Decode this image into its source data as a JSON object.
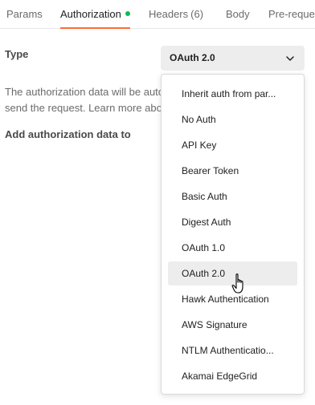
{
  "tabs": [
    {
      "label": "Params",
      "active": false
    },
    {
      "label": "Authorization",
      "active": true,
      "status_dot": true
    },
    {
      "label": "Headers",
      "count": "(6)",
      "active": false
    },
    {
      "label": "Body",
      "active": false
    },
    {
      "label": "Pre-reque",
      "active": false
    }
  ],
  "auth": {
    "type_label": "Type",
    "description_line1": "The authorization data will be auto",
    "description_line2": "send the request. Learn more abou",
    "add_to_label": "Add authorization data to"
  },
  "select": {
    "value": "OAuth 2.0"
  },
  "menu": {
    "items": [
      "Inherit auth from par...",
      "No Auth",
      "API Key",
      "Bearer Token",
      "Basic Auth",
      "Digest Auth",
      "OAuth 1.0",
      "OAuth 2.0",
      "Hawk Authentication",
      "AWS Signature",
      "NTLM Authenticatio...",
      "Akamai EdgeGrid"
    ],
    "hovered": "OAuth 2.0"
  },
  "colors": {
    "accent": "#ff6c37",
    "status_dot": "#0cbb52",
    "select_bg": "#ededed"
  },
  "icons": {
    "select_chevron": "chevron-down-icon",
    "pointer": "hand-pointer-icon"
  }
}
